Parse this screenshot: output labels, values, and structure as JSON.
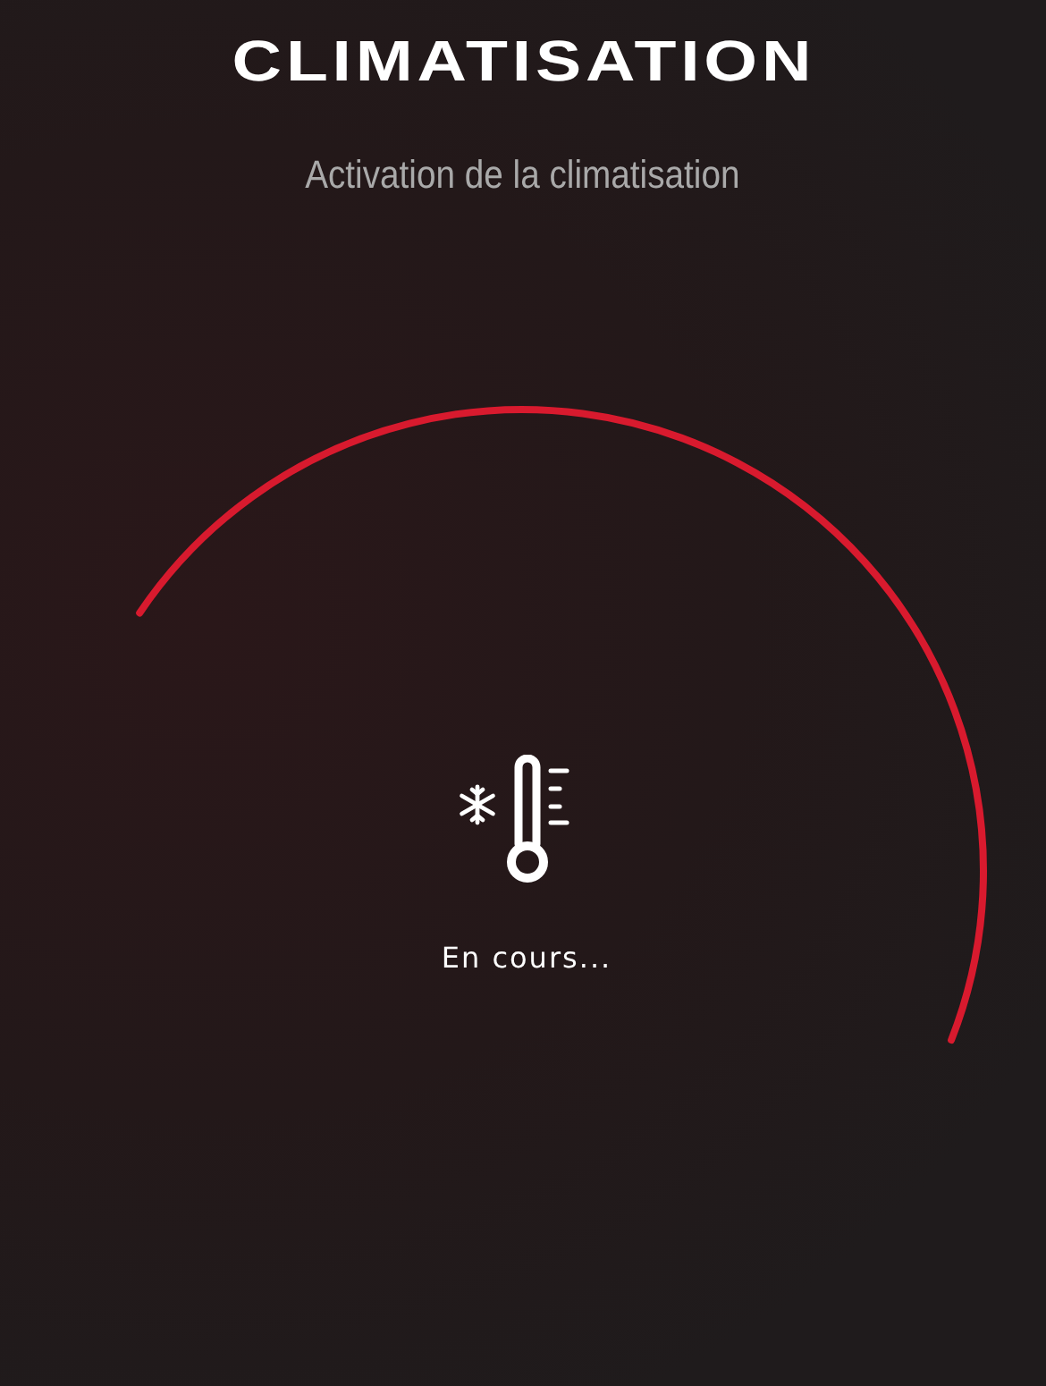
{
  "header": {
    "title": "CLIMATISATION",
    "subtitle": "Activation de la climatisation"
  },
  "status": {
    "label": "En cours..."
  }
}
